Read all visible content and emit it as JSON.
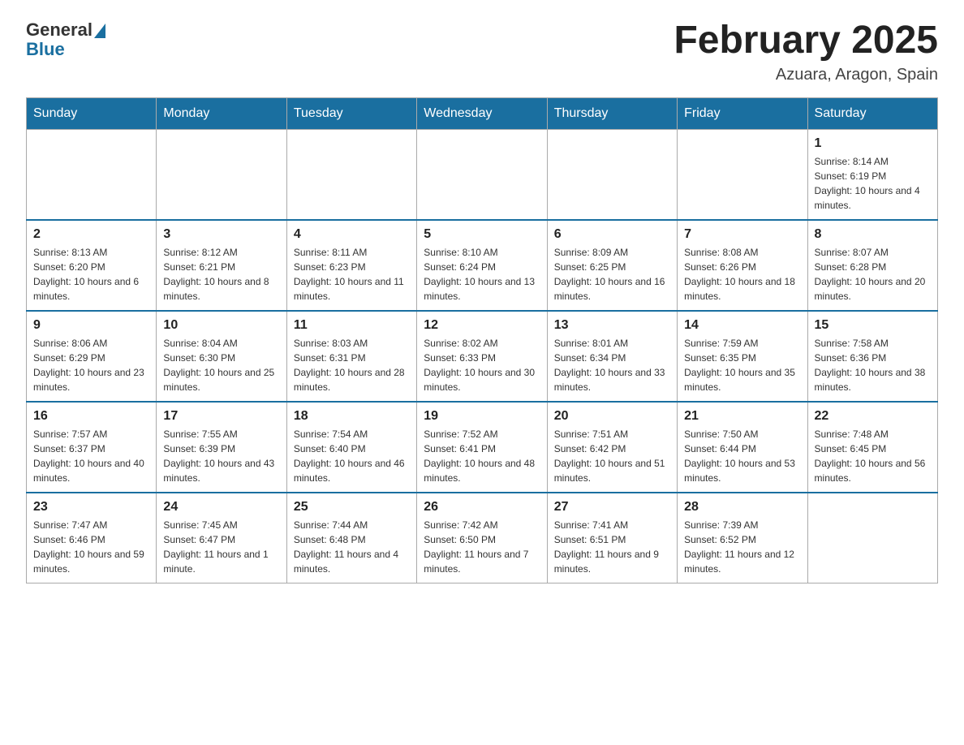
{
  "header": {
    "logo_general": "General",
    "logo_blue": "Blue",
    "month_title": "February 2025",
    "location": "Azuara, Aragon, Spain"
  },
  "weekdays": [
    "Sunday",
    "Monday",
    "Tuesday",
    "Wednesday",
    "Thursday",
    "Friday",
    "Saturday"
  ],
  "weeks": [
    {
      "days": [
        {
          "number": "",
          "info": "",
          "empty": true
        },
        {
          "number": "",
          "info": "",
          "empty": true
        },
        {
          "number": "",
          "info": "",
          "empty": true
        },
        {
          "number": "",
          "info": "",
          "empty": true
        },
        {
          "number": "",
          "info": "",
          "empty": true
        },
        {
          "number": "",
          "info": "",
          "empty": true
        },
        {
          "number": "1",
          "info": "Sunrise: 8:14 AM\nSunset: 6:19 PM\nDaylight: 10 hours and 4 minutes.",
          "empty": false
        }
      ]
    },
    {
      "days": [
        {
          "number": "2",
          "info": "Sunrise: 8:13 AM\nSunset: 6:20 PM\nDaylight: 10 hours and 6 minutes.",
          "empty": false
        },
        {
          "number": "3",
          "info": "Sunrise: 8:12 AM\nSunset: 6:21 PM\nDaylight: 10 hours and 8 minutes.",
          "empty": false
        },
        {
          "number": "4",
          "info": "Sunrise: 8:11 AM\nSunset: 6:23 PM\nDaylight: 10 hours and 11 minutes.",
          "empty": false
        },
        {
          "number": "5",
          "info": "Sunrise: 8:10 AM\nSunset: 6:24 PM\nDaylight: 10 hours and 13 minutes.",
          "empty": false
        },
        {
          "number": "6",
          "info": "Sunrise: 8:09 AM\nSunset: 6:25 PM\nDaylight: 10 hours and 16 minutes.",
          "empty": false
        },
        {
          "number": "7",
          "info": "Sunrise: 8:08 AM\nSunset: 6:26 PM\nDaylight: 10 hours and 18 minutes.",
          "empty": false
        },
        {
          "number": "8",
          "info": "Sunrise: 8:07 AM\nSunset: 6:28 PM\nDaylight: 10 hours and 20 minutes.",
          "empty": false
        }
      ]
    },
    {
      "days": [
        {
          "number": "9",
          "info": "Sunrise: 8:06 AM\nSunset: 6:29 PM\nDaylight: 10 hours and 23 minutes.",
          "empty": false
        },
        {
          "number": "10",
          "info": "Sunrise: 8:04 AM\nSunset: 6:30 PM\nDaylight: 10 hours and 25 minutes.",
          "empty": false
        },
        {
          "number": "11",
          "info": "Sunrise: 8:03 AM\nSunset: 6:31 PM\nDaylight: 10 hours and 28 minutes.",
          "empty": false
        },
        {
          "number": "12",
          "info": "Sunrise: 8:02 AM\nSunset: 6:33 PM\nDaylight: 10 hours and 30 minutes.",
          "empty": false
        },
        {
          "number": "13",
          "info": "Sunrise: 8:01 AM\nSunset: 6:34 PM\nDaylight: 10 hours and 33 minutes.",
          "empty": false
        },
        {
          "number": "14",
          "info": "Sunrise: 7:59 AM\nSunset: 6:35 PM\nDaylight: 10 hours and 35 minutes.",
          "empty": false
        },
        {
          "number": "15",
          "info": "Sunrise: 7:58 AM\nSunset: 6:36 PM\nDaylight: 10 hours and 38 minutes.",
          "empty": false
        }
      ]
    },
    {
      "days": [
        {
          "number": "16",
          "info": "Sunrise: 7:57 AM\nSunset: 6:37 PM\nDaylight: 10 hours and 40 minutes.",
          "empty": false
        },
        {
          "number": "17",
          "info": "Sunrise: 7:55 AM\nSunset: 6:39 PM\nDaylight: 10 hours and 43 minutes.",
          "empty": false
        },
        {
          "number": "18",
          "info": "Sunrise: 7:54 AM\nSunset: 6:40 PM\nDaylight: 10 hours and 46 minutes.",
          "empty": false
        },
        {
          "number": "19",
          "info": "Sunrise: 7:52 AM\nSunset: 6:41 PM\nDaylight: 10 hours and 48 minutes.",
          "empty": false
        },
        {
          "number": "20",
          "info": "Sunrise: 7:51 AM\nSunset: 6:42 PM\nDaylight: 10 hours and 51 minutes.",
          "empty": false
        },
        {
          "number": "21",
          "info": "Sunrise: 7:50 AM\nSunset: 6:44 PM\nDaylight: 10 hours and 53 minutes.",
          "empty": false
        },
        {
          "number": "22",
          "info": "Sunrise: 7:48 AM\nSunset: 6:45 PM\nDaylight: 10 hours and 56 minutes.",
          "empty": false
        }
      ]
    },
    {
      "days": [
        {
          "number": "23",
          "info": "Sunrise: 7:47 AM\nSunset: 6:46 PM\nDaylight: 10 hours and 59 minutes.",
          "empty": false
        },
        {
          "number": "24",
          "info": "Sunrise: 7:45 AM\nSunset: 6:47 PM\nDaylight: 11 hours and 1 minute.",
          "empty": false
        },
        {
          "number": "25",
          "info": "Sunrise: 7:44 AM\nSunset: 6:48 PM\nDaylight: 11 hours and 4 minutes.",
          "empty": false
        },
        {
          "number": "26",
          "info": "Sunrise: 7:42 AM\nSunset: 6:50 PM\nDaylight: 11 hours and 7 minutes.",
          "empty": false
        },
        {
          "number": "27",
          "info": "Sunrise: 7:41 AM\nSunset: 6:51 PM\nDaylight: 11 hours and 9 minutes.",
          "empty": false
        },
        {
          "number": "28",
          "info": "Sunrise: 7:39 AM\nSunset: 6:52 PM\nDaylight: 11 hours and 12 minutes.",
          "empty": false
        },
        {
          "number": "",
          "info": "",
          "empty": true
        }
      ]
    }
  ]
}
